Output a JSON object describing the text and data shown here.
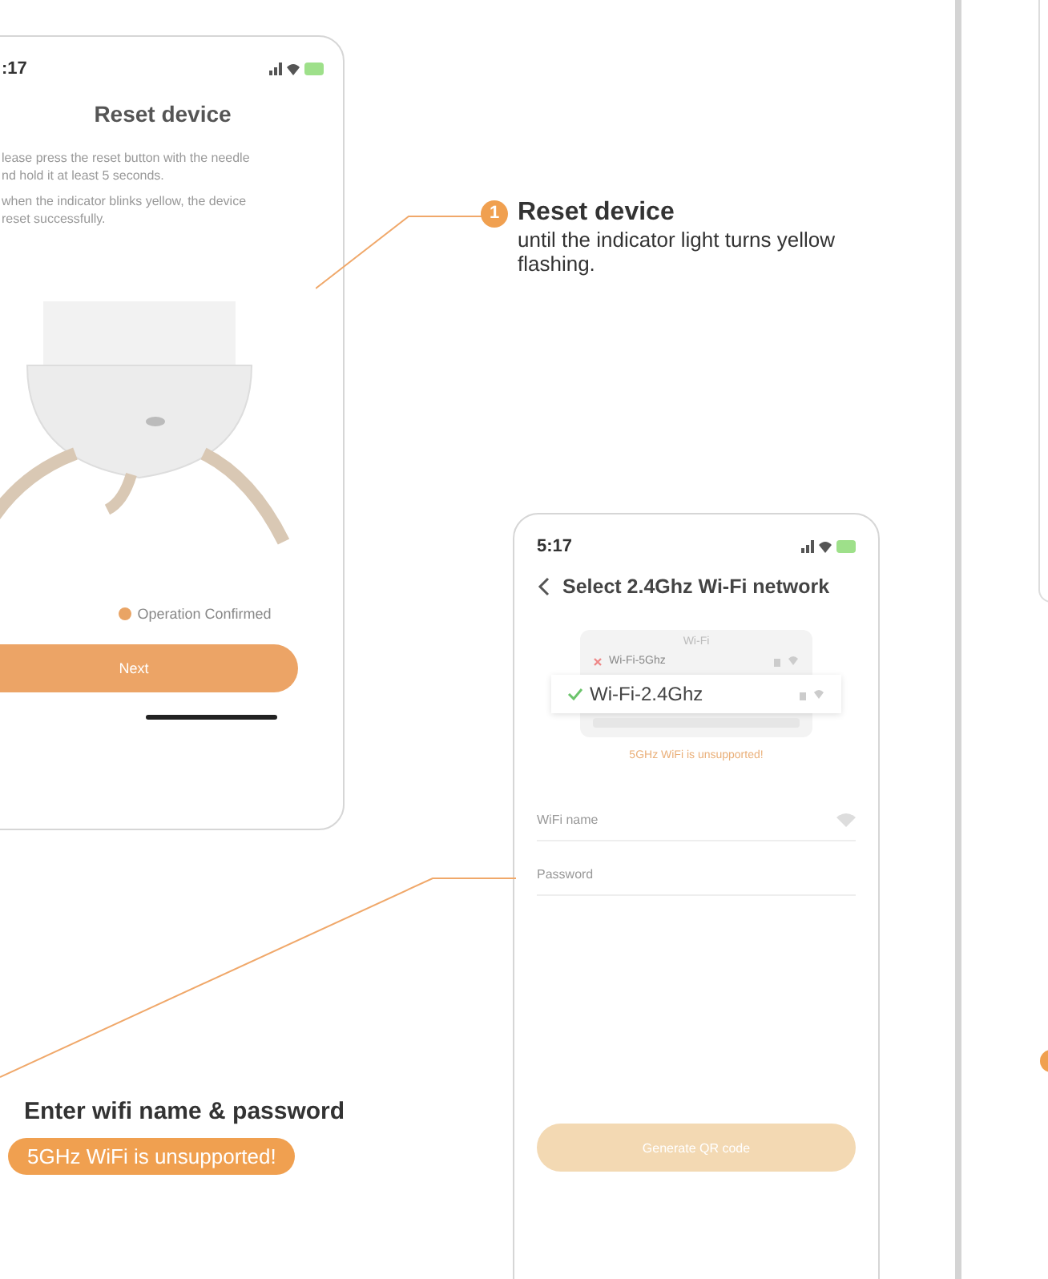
{
  "reset_screen": {
    "status_time": ":17",
    "title": "Reset device",
    "instructions": [
      "lease press the reset button with the needle",
      "nd hold it at least 5 seconds.",
      "when the indicator blinks yellow, the device",
      "reset successfully."
    ],
    "confirm": {
      "label": "Operation Confirmed",
      "checked": true
    },
    "button": "Next"
  },
  "reset_callout": {
    "number": "1",
    "title": "Reset device",
    "text": "until the indicator light turns yellow flashing."
  },
  "wifi_screen": {
    "status_time": "5:17",
    "title": "Select 2.4Ghz Wi-Fi network",
    "picker": {
      "header": "Wi-Fi",
      "networks": [
        {
          "name": "Wi-Fi-5Ghz",
          "selected": false
        },
        {
          "name": "Wi-Fi-2.4Ghz",
          "selected": true
        }
      ]
    },
    "warning": "5GHz WiFi is unsupported!",
    "fields": [
      {
        "placeholder": "WiFi name",
        "kind": "wifi"
      },
      {
        "placeholder": "Password",
        "kind": "plain"
      }
    ],
    "button": "Generate QR code"
  },
  "wifi_callout": {
    "title": "Enter wifi name & password",
    "badge": "5GHz WiFi is unsupported!"
  }
}
